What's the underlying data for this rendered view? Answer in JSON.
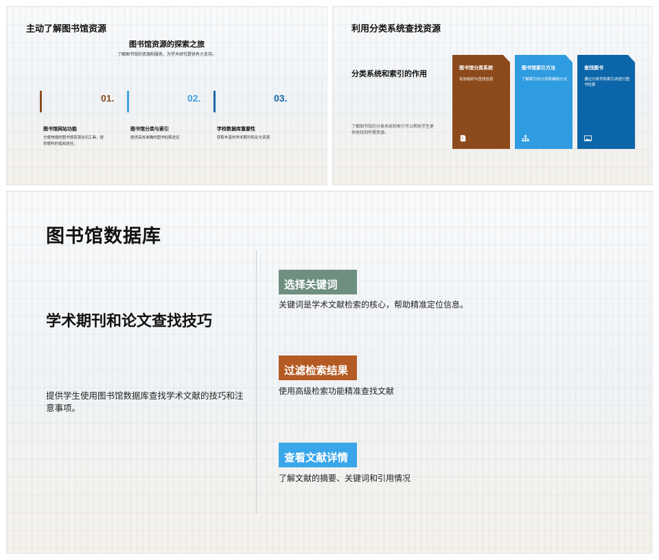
{
  "slide1": {
    "title": "主动了解图书馆资源",
    "subtitle": "图书馆资源的探索之旅",
    "desc": "了解图书馆的资源和服务，为学术研究提供有力支持。",
    "steps": [
      {
        "num": "01.",
        "head": "图书馆网站功能",
        "text": "方便快捷的图书馆资源访问工具，提供便利的借阅途径。",
        "color": "#8a4a1e"
      },
      {
        "num": "02.",
        "head": "图书馆分类与索引",
        "text": "提供高效准确的图书检索途径",
        "color": "#3aa3e0"
      },
      {
        "num": "03.",
        "head": "学校数据库重要性",
        "text": "获取丰富的学术期刊和论文资源",
        "color": "#1466a8"
      }
    ]
  },
  "slide2": {
    "title": "利用分类系统查找资源",
    "subhead": "分类系统和索引的作用",
    "subdesc": "了解图书馆的分类系统和索引可以帮助学生更快地找到所需资源。",
    "cards": [
      {
        "head": "图书馆分类系统",
        "text": "有效组织与查找信息",
        "icon": "document-icon",
        "color": "#8c4a1c"
      },
      {
        "head": "图书馆索引方法",
        "text": "了解索引的分类和编制方式",
        "icon": "hierarchy-icon",
        "color": "#2f9be0"
      },
      {
        "head": "查找图书",
        "text": "通过分类号和索引词进行图书检索",
        "icon": "image-icon",
        "color": "#0b65a8"
      }
    ]
  },
  "slide3": {
    "title": "图书馆数据库",
    "left_head": "学术期刊和论文查找技巧",
    "left_desc": "提供学生使用图书馆数据库查找学术文献的技巧和注意事项。",
    "items": [
      {
        "tag": "选择关键词",
        "text": "关键词是学术文献检索的核心，帮助精准定位信息。",
        "color": "#6f8f80"
      },
      {
        "tag": "过滤检索结果",
        "text": "使用高级检索功能精准查找文献",
        "color": "#b45b24"
      },
      {
        "tag": "查看文献详情",
        "text": "了解文献的摘要、关键词和引用情况",
        "color": "#3aa6ea"
      }
    ]
  }
}
